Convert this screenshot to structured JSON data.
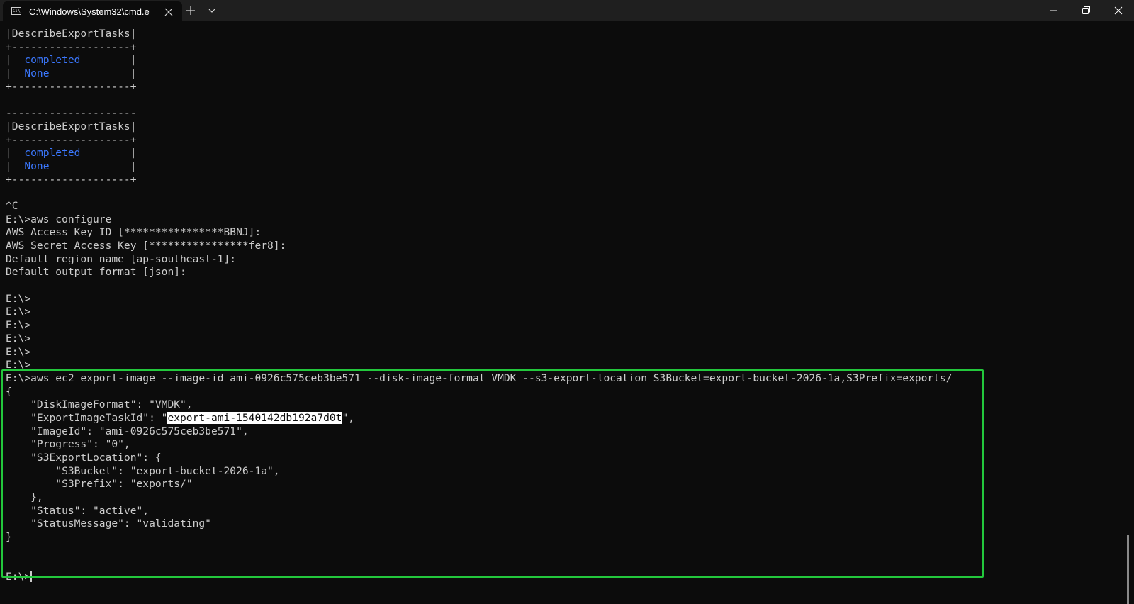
{
  "window": {
    "tab_title": "C:\\Windows\\System32\\cmd.e",
    "tab_icon_text": "C:\\"
  },
  "terminal": {
    "lines": [
      {
        "segments": [
          {
            "text": "|DescribeExportTasks|"
          }
        ]
      },
      {
        "segments": [
          {
            "text": "+-------------------+"
          }
        ]
      },
      {
        "segments": [
          {
            "text": "|  "
          },
          {
            "text": "completed",
            "style": "blue"
          },
          {
            "text": "        |"
          }
        ]
      },
      {
        "segments": [
          {
            "text": "|  "
          },
          {
            "text": "None",
            "style": "blue"
          },
          {
            "text": "             |"
          }
        ]
      },
      {
        "segments": [
          {
            "text": "+-------------------+"
          }
        ]
      },
      {
        "segments": [
          {
            "text": ""
          }
        ]
      },
      {
        "segments": [
          {
            "text": "---------------------"
          }
        ]
      },
      {
        "segments": [
          {
            "text": "|DescribeExportTasks|"
          }
        ]
      },
      {
        "segments": [
          {
            "text": "+-------------------+"
          }
        ]
      },
      {
        "segments": [
          {
            "text": "|  "
          },
          {
            "text": "completed",
            "style": "blue"
          },
          {
            "text": "        |"
          }
        ]
      },
      {
        "segments": [
          {
            "text": "|  "
          },
          {
            "text": "None",
            "style": "blue"
          },
          {
            "text": "             |"
          }
        ]
      },
      {
        "segments": [
          {
            "text": "+-------------------+"
          }
        ]
      },
      {
        "segments": [
          {
            "text": ""
          }
        ]
      },
      {
        "segments": [
          {
            "text": "^C"
          }
        ]
      },
      {
        "segments": [
          {
            "text": "E:\\>aws configure"
          }
        ]
      },
      {
        "segments": [
          {
            "text": "AWS Access Key ID [****************BBNJ]:"
          }
        ]
      },
      {
        "segments": [
          {
            "text": "AWS Secret Access Key [****************fer8]:"
          }
        ]
      },
      {
        "segments": [
          {
            "text": "Default region name [ap-southeast-1]:"
          }
        ]
      },
      {
        "segments": [
          {
            "text": "Default output format [json]:"
          }
        ]
      },
      {
        "segments": [
          {
            "text": ""
          }
        ]
      },
      {
        "segments": [
          {
            "text": "E:\\>"
          }
        ]
      },
      {
        "segments": [
          {
            "text": "E:\\>"
          }
        ]
      },
      {
        "segments": [
          {
            "text": "E:\\>"
          }
        ]
      },
      {
        "segments": [
          {
            "text": "E:\\>"
          }
        ]
      },
      {
        "segments": [
          {
            "text": "E:\\>"
          }
        ]
      },
      {
        "segments": [
          {
            "text": "E:\\>"
          }
        ]
      },
      {
        "segments": [
          {
            "text": "E:\\>aws ec2 export-image --image-id ami-0926c575ceb3be571 --disk-image-format VMDK --s3-export-location S3Bucket=export-bucket-2026-1a,S3Prefix=exports/"
          }
        ]
      },
      {
        "segments": [
          {
            "text": "{"
          }
        ]
      },
      {
        "segments": [
          {
            "text": "    \"DiskImageFormat\": \"VMDK\","
          }
        ]
      },
      {
        "segments": [
          {
            "text": "    \"ExportImageTaskId\": \""
          },
          {
            "text": "export-ami-1540142db192a7d0t",
            "style": "hl"
          },
          {
            "text": "\","
          }
        ]
      },
      {
        "segments": [
          {
            "text": "    \"ImageId\": \"ami-0926c575ceb3be571\","
          }
        ]
      },
      {
        "segments": [
          {
            "text": "    \"Progress\": \"0\","
          }
        ]
      },
      {
        "segments": [
          {
            "text": "    \"S3ExportLocation\": {"
          }
        ]
      },
      {
        "segments": [
          {
            "text": "        \"S3Bucket\": \"export-bucket-2026-1a\","
          }
        ]
      },
      {
        "segments": [
          {
            "text": "        \"S3Prefix\": \"exports/\""
          }
        ]
      },
      {
        "segments": [
          {
            "text": "    },"
          }
        ]
      },
      {
        "segments": [
          {
            "text": "    \"Status\": \"active\","
          }
        ]
      },
      {
        "segments": [
          {
            "text": "    \"StatusMessage\": \"validating\""
          }
        ]
      },
      {
        "segments": [
          {
            "text": "}"
          }
        ]
      },
      {
        "segments": [
          {
            "text": ""
          }
        ]
      },
      {
        "segments": [
          {
            "text": ""
          }
        ]
      },
      {
        "segments": [
          {
            "text": "E:\\>"
          }
        ],
        "cursor": true
      }
    ]
  },
  "colors": {
    "background": "#0c0c0c",
    "foreground": "#cccccc",
    "accent_blue": "#3b78ff",
    "highlight_border": "#23c83c",
    "titlebar": "#1f1f1f"
  }
}
